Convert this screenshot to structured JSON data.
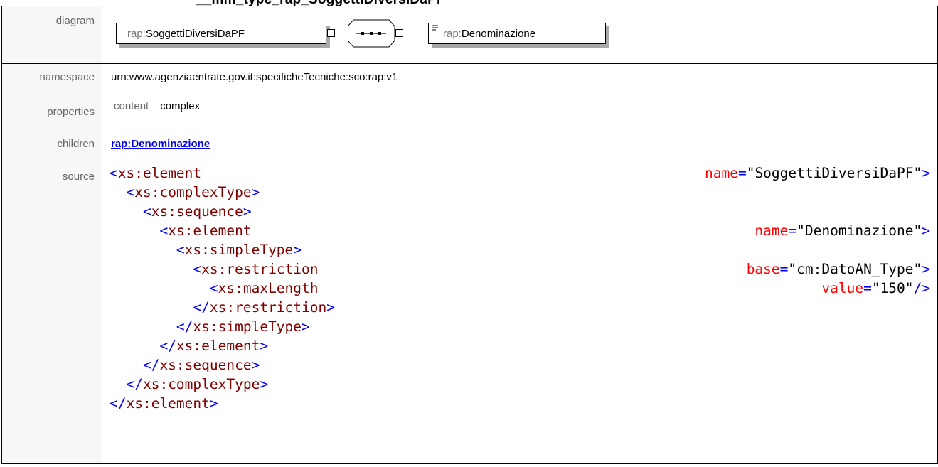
{
  "heading": "__mm_type_rap_SoggettiDiversiDaPF",
  "rows": {
    "diagram_label": "diagram",
    "namespace_label": "namespace",
    "namespace_value": "urn:www.agenziaentrate.gov.it:specificheTecniche:sco:rap:v1",
    "properties_label": "properties",
    "children_label": "children",
    "source_label": "source"
  },
  "diagram": {
    "main_prefix": "rap:",
    "main_name": "SoggettiDiversiDaPF",
    "child_prefix": "rap:",
    "child_name": "Denominazione",
    "icons": [
      "collapse-icon",
      "sequence-icon",
      "documentation-icon"
    ]
  },
  "properties": {
    "content_label": "content",
    "content_value": "complex"
  },
  "children": {
    "link": "rap:Denominazione"
  },
  "source": {
    "lines": [
      {
        "indent": "",
        "open": "<",
        "tag": "xs:element",
        "attr_name": "name",
        "eq": "=\"",
        "attr_value": "SoggettiDiversiDaPF",
        "close_attr": "\">",
        "close": ""
      },
      {
        "indent": "  ",
        "open": "<",
        "tag": "xs:complexType",
        "attr_name": "",
        "eq": "",
        "attr_value": "",
        "close_attr": "",
        "close": ">"
      },
      {
        "indent": "    ",
        "open": "<",
        "tag": "xs:sequence",
        "attr_name": "",
        "eq": "",
        "attr_value": "",
        "close_attr": "",
        "close": ">"
      },
      {
        "indent": "      ",
        "open": "<",
        "tag": "xs:element",
        "attr_name": "name",
        "eq": "=\"",
        "attr_value": "Denominazione",
        "close_attr": "\">",
        "close": ""
      },
      {
        "indent": "        ",
        "open": "<",
        "tag": "xs:simpleType",
        "attr_name": "",
        "eq": "",
        "attr_value": "",
        "close_attr": "",
        "close": ">"
      },
      {
        "indent": "          ",
        "open": "<",
        "tag": "xs:restriction",
        "attr_name": "base",
        "eq": "=\"",
        "attr_value": "cm:DatoAN_Type",
        "close_attr": "\">",
        "close": ""
      },
      {
        "indent": "            ",
        "open": "<",
        "tag": "xs:maxLength",
        "attr_name": "value",
        "eq": "=\"",
        "attr_value": "150",
        "close_attr": "\"/>",
        "close": ""
      },
      {
        "indent": "          ",
        "open": "</",
        "tag": "xs:restriction",
        "attr_name": "",
        "eq": "",
        "attr_value": "",
        "close_attr": "",
        "close": ">"
      },
      {
        "indent": "        ",
        "open": "</",
        "tag": "xs:simpleType",
        "attr_name": "",
        "eq": "",
        "attr_value": "",
        "close_attr": "",
        "close": ">"
      },
      {
        "indent": "      ",
        "open": "</",
        "tag": "xs:element",
        "attr_name": "",
        "eq": "",
        "attr_value": "",
        "close_attr": "",
        "close": ">"
      },
      {
        "indent": "    ",
        "open": "</",
        "tag": "xs:sequence",
        "attr_name": "",
        "eq": "",
        "attr_value": "",
        "close_attr": "",
        "close": ">"
      },
      {
        "indent": "  ",
        "open": "</",
        "tag": "xs:complexType",
        "attr_name": "",
        "eq": "",
        "attr_value": "",
        "close_attr": "",
        "close": ">"
      },
      {
        "indent": "",
        "open": "</",
        "tag": "xs:element",
        "attr_name": "",
        "eq": "",
        "attr_value": "",
        "close_attr": "",
        "close": ">"
      }
    ]
  },
  "colors": {
    "tag": "#800000",
    "punctuation": "#0000ff",
    "attribute_name": "#ff0000",
    "attribute_value": "#000000",
    "link": "#0000ee",
    "label_text": "#666666"
  }
}
